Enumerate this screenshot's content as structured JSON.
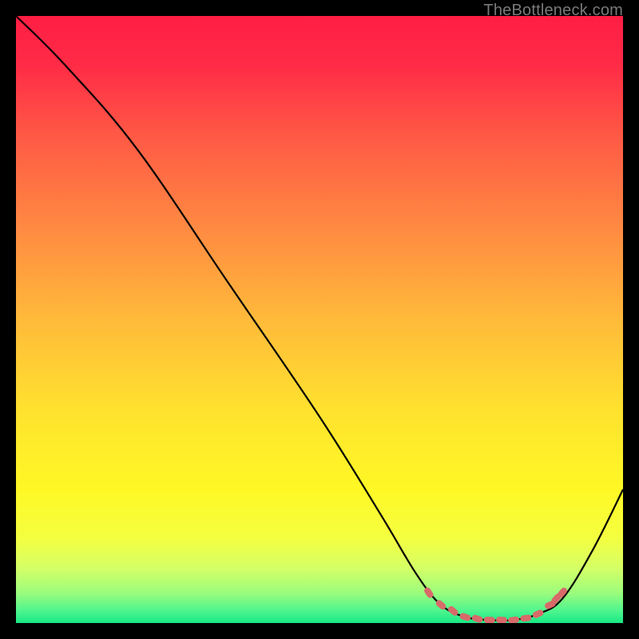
{
  "watermark": "TheBottleneck.com",
  "chart_data": {
    "type": "line",
    "title": "",
    "xlabel": "",
    "ylabel": "",
    "xlim": [
      0,
      100
    ],
    "ylim": [
      0,
      100
    ],
    "series": [
      {
        "name": "curve",
        "points": [
          {
            "x": 0,
            "y": 100
          },
          {
            "x": 8,
            "y": 92
          },
          {
            "x": 20,
            "y": 78
          },
          {
            "x": 35,
            "y": 56
          },
          {
            "x": 50,
            "y": 34
          },
          {
            "x": 60,
            "y": 18
          },
          {
            "x": 66,
            "y": 8
          },
          {
            "x": 70,
            "y": 3
          },
          {
            "x": 74,
            "y": 1
          },
          {
            "x": 78,
            "y": 0.5
          },
          {
            "x": 82,
            "y": 0.5
          },
          {
            "x": 86,
            "y": 1.5
          },
          {
            "x": 90,
            "y": 4
          },
          {
            "x": 95,
            "y": 12
          },
          {
            "x": 100,
            "y": 22
          }
        ]
      },
      {
        "name": "markers",
        "points": [
          {
            "x": 68,
            "y": 5
          },
          {
            "x": 70,
            "y": 3
          },
          {
            "x": 72,
            "y": 2
          },
          {
            "x": 74,
            "y": 1
          },
          {
            "x": 76,
            "y": 0.7
          },
          {
            "x": 78,
            "y": 0.5
          },
          {
            "x": 80,
            "y": 0.5
          },
          {
            "x": 82,
            "y": 0.5
          },
          {
            "x": 84,
            "y": 0.8
          },
          {
            "x": 86,
            "y": 1.5
          },
          {
            "x": 88,
            "y": 3
          },
          {
            "x": 89,
            "y": 4
          },
          {
            "x": 90,
            "y": 5
          }
        ]
      }
    ],
    "gradient_stops": [
      {
        "offset": 0.0,
        "color": "#ff1e44"
      },
      {
        "offset": 0.08,
        "color": "#ff2b46"
      },
      {
        "offset": 0.2,
        "color": "#ff5a45"
      },
      {
        "offset": 0.35,
        "color": "#ff8a42"
      },
      {
        "offset": 0.5,
        "color": "#ffba3a"
      },
      {
        "offset": 0.65,
        "color": "#ffe22e"
      },
      {
        "offset": 0.78,
        "color": "#fff825"
      },
      {
        "offset": 0.86,
        "color": "#f4ff40"
      },
      {
        "offset": 0.91,
        "color": "#d4ff66"
      },
      {
        "offset": 0.95,
        "color": "#9cfc7c"
      },
      {
        "offset": 0.98,
        "color": "#4ef58e"
      },
      {
        "offset": 1.0,
        "color": "#17e884"
      }
    ],
    "marker_color": "#d86a6a",
    "curve_color": "#000000"
  }
}
